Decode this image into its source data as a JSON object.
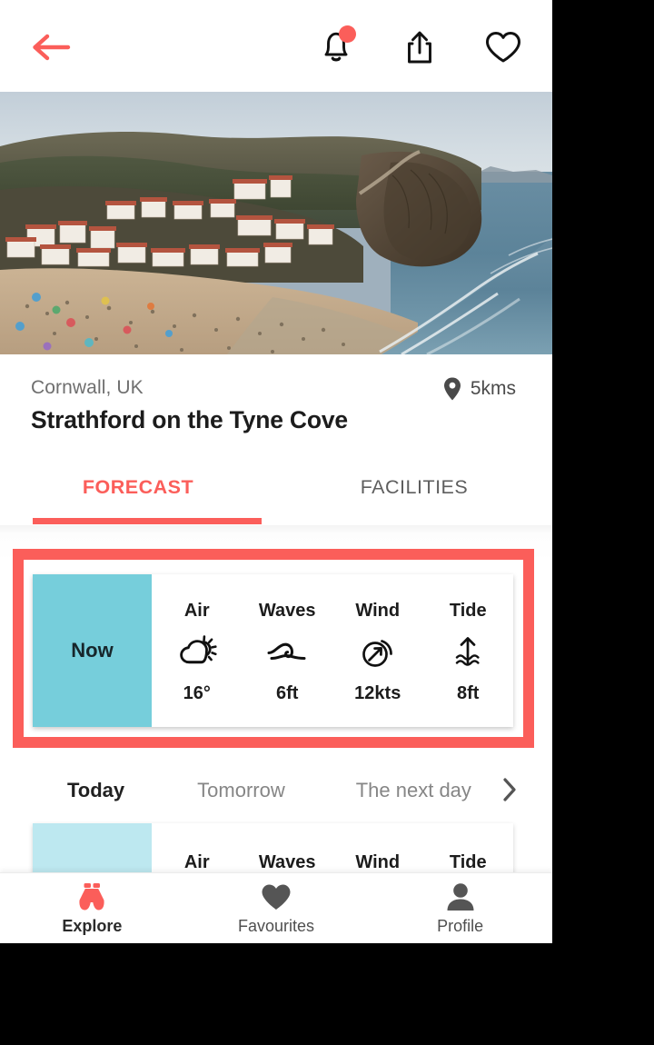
{
  "appbar": {
    "back_icon": "arrow-left-icon",
    "notification_icon": "bell-icon",
    "notification_badge": "",
    "share_icon": "share-upload-icon",
    "favourite_icon": "heart-outline-icon"
  },
  "hero": {
    "alt": "coastal village beach with cliff headland"
  },
  "location": {
    "region": "Cornwall, UK",
    "distance": "5kms",
    "distance_icon": "map-pin-icon",
    "title": "Strathford on the Tyne Cove"
  },
  "tabs": [
    {
      "label": "FORECAST",
      "active": true
    },
    {
      "label": "FACILITIES",
      "active": false
    }
  ],
  "forecast": {
    "now_card": {
      "label": "Now",
      "columns": [
        {
          "head": "Air",
          "icon": "partly-cloudy-icon",
          "value": "16°"
        },
        {
          "head": "Waves",
          "icon": "wave-icon",
          "value": "6ft"
        },
        {
          "head": "Wind",
          "icon": "wind-direction-icon",
          "value": "12kts"
        },
        {
          "head": "Tide",
          "icon": "tide-rising-icon",
          "value": "8ft"
        }
      ]
    },
    "days": [
      {
        "label": "Today",
        "active": true
      },
      {
        "label": "Tomorrow",
        "active": false
      },
      {
        "label": "The next day",
        "active": false
      }
    ],
    "days_next_icon": "chevron-right-icon",
    "next_card": {
      "label": "",
      "columns": [
        {
          "head": "Air"
        },
        {
          "head": "Waves"
        },
        {
          "head": "Wind"
        },
        {
          "head": "Tide"
        }
      ]
    }
  },
  "bottomnav": [
    {
      "label": "Explore",
      "icon": "binoculars-icon",
      "active": true
    },
    {
      "label": "Favourites",
      "icon": "heart-filled-icon",
      "active": false
    },
    {
      "label": "Profile",
      "icon": "person-icon",
      "active": false
    }
  ],
  "colors": {
    "accent_red": "#FB5E5A",
    "card_teal": "#76CEDB",
    "card_teal_light": "#BDE8F0",
    "text_dark": "#1c1c1c",
    "text_muted": "#868686"
  }
}
